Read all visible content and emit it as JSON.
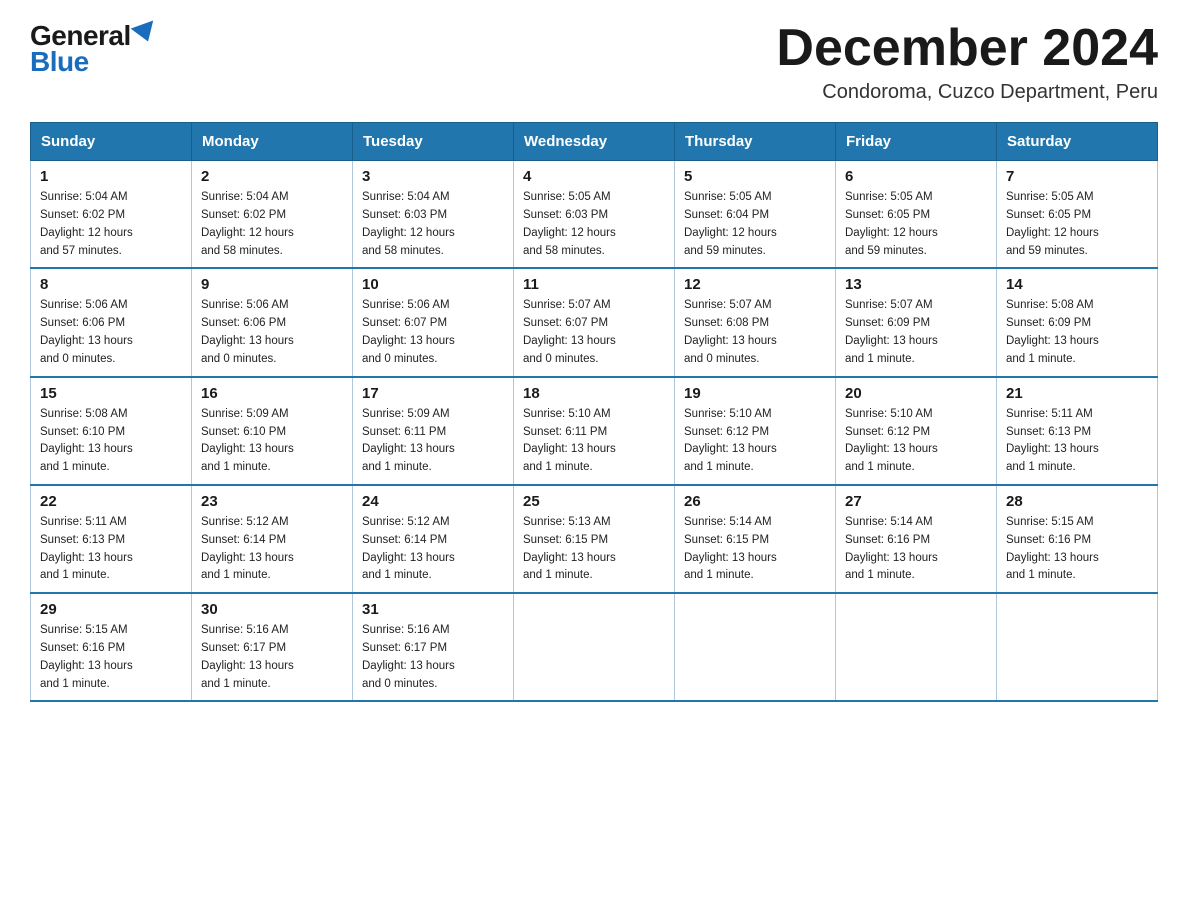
{
  "header": {
    "logo_general": "General",
    "logo_blue": "Blue",
    "month_title": "December 2024",
    "location": "Condoroma, Cuzco Department, Peru"
  },
  "days_of_week": [
    "Sunday",
    "Monday",
    "Tuesday",
    "Wednesday",
    "Thursday",
    "Friday",
    "Saturday"
  ],
  "weeks": [
    [
      {
        "day": 1,
        "sunrise": "5:04 AM",
        "sunset": "6:02 PM",
        "daylight": "12 hours and 57 minutes."
      },
      {
        "day": 2,
        "sunrise": "5:04 AM",
        "sunset": "6:02 PM",
        "daylight": "12 hours and 58 minutes."
      },
      {
        "day": 3,
        "sunrise": "5:04 AM",
        "sunset": "6:03 PM",
        "daylight": "12 hours and 58 minutes."
      },
      {
        "day": 4,
        "sunrise": "5:05 AM",
        "sunset": "6:03 PM",
        "daylight": "12 hours and 58 minutes."
      },
      {
        "day": 5,
        "sunrise": "5:05 AM",
        "sunset": "6:04 PM",
        "daylight": "12 hours and 59 minutes."
      },
      {
        "day": 6,
        "sunrise": "5:05 AM",
        "sunset": "6:05 PM",
        "daylight": "12 hours and 59 minutes."
      },
      {
        "day": 7,
        "sunrise": "5:05 AM",
        "sunset": "6:05 PM",
        "daylight": "12 hours and 59 minutes."
      }
    ],
    [
      {
        "day": 8,
        "sunrise": "5:06 AM",
        "sunset": "6:06 PM",
        "daylight": "13 hours and 0 minutes."
      },
      {
        "day": 9,
        "sunrise": "5:06 AM",
        "sunset": "6:06 PM",
        "daylight": "13 hours and 0 minutes."
      },
      {
        "day": 10,
        "sunrise": "5:06 AM",
        "sunset": "6:07 PM",
        "daylight": "13 hours and 0 minutes."
      },
      {
        "day": 11,
        "sunrise": "5:07 AM",
        "sunset": "6:07 PM",
        "daylight": "13 hours and 0 minutes."
      },
      {
        "day": 12,
        "sunrise": "5:07 AM",
        "sunset": "6:08 PM",
        "daylight": "13 hours and 0 minutes."
      },
      {
        "day": 13,
        "sunrise": "5:07 AM",
        "sunset": "6:09 PM",
        "daylight": "13 hours and 1 minute."
      },
      {
        "day": 14,
        "sunrise": "5:08 AM",
        "sunset": "6:09 PM",
        "daylight": "13 hours and 1 minute."
      }
    ],
    [
      {
        "day": 15,
        "sunrise": "5:08 AM",
        "sunset": "6:10 PM",
        "daylight": "13 hours and 1 minute."
      },
      {
        "day": 16,
        "sunrise": "5:09 AM",
        "sunset": "6:10 PM",
        "daylight": "13 hours and 1 minute."
      },
      {
        "day": 17,
        "sunrise": "5:09 AM",
        "sunset": "6:11 PM",
        "daylight": "13 hours and 1 minute."
      },
      {
        "day": 18,
        "sunrise": "5:10 AM",
        "sunset": "6:11 PM",
        "daylight": "13 hours and 1 minute."
      },
      {
        "day": 19,
        "sunrise": "5:10 AM",
        "sunset": "6:12 PM",
        "daylight": "13 hours and 1 minute."
      },
      {
        "day": 20,
        "sunrise": "5:10 AM",
        "sunset": "6:12 PM",
        "daylight": "13 hours and 1 minute."
      },
      {
        "day": 21,
        "sunrise": "5:11 AM",
        "sunset": "6:13 PM",
        "daylight": "13 hours and 1 minute."
      }
    ],
    [
      {
        "day": 22,
        "sunrise": "5:11 AM",
        "sunset": "6:13 PM",
        "daylight": "13 hours and 1 minute."
      },
      {
        "day": 23,
        "sunrise": "5:12 AM",
        "sunset": "6:14 PM",
        "daylight": "13 hours and 1 minute."
      },
      {
        "day": 24,
        "sunrise": "5:12 AM",
        "sunset": "6:14 PM",
        "daylight": "13 hours and 1 minute."
      },
      {
        "day": 25,
        "sunrise": "5:13 AM",
        "sunset": "6:15 PM",
        "daylight": "13 hours and 1 minute."
      },
      {
        "day": 26,
        "sunrise": "5:14 AM",
        "sunset": "6:15 PM",
        "daylight": "13 hours and 1 minute."
      },
      {
        "day": 27,
        "sunrise": "5:14 AM",
        "sunset": "6:16 PM",
        "daylight": "13 hours and 1 minute."
      },
      {
        "day": 28,
        "sunrise": "5:15 AM",
        "sunset": "6:16 PM",
        "daylight": "13 hours and 1 minute."
      }
    ],
    [
      {
        "day": 29,
        "sunrise": "5:15 AM",
        "sunset": "6:16 PM",
        "daylight": "13 hours and 1 minute."
      },
      {
        "day": 30,
        "sunrise": "5:16 AM",
        "sunset": "6:17 PM",
        "daylight": "13 hours and 1 minute."
      },
      {
        "day": 31,
        "sunrise": "5:16 AM",
        "sunset": "6:17 PM",
        "daylight": "13 hours and 0 minutes."
      },
      null,
      null,
      null,
      null
    ]
  ],
  "labels": {
    "sunrise_prefix": "Sunrise: ",
    "sunset_prefix": "Sunset: ",
    "daylight_prefix": "Daylight: "
  }
}
